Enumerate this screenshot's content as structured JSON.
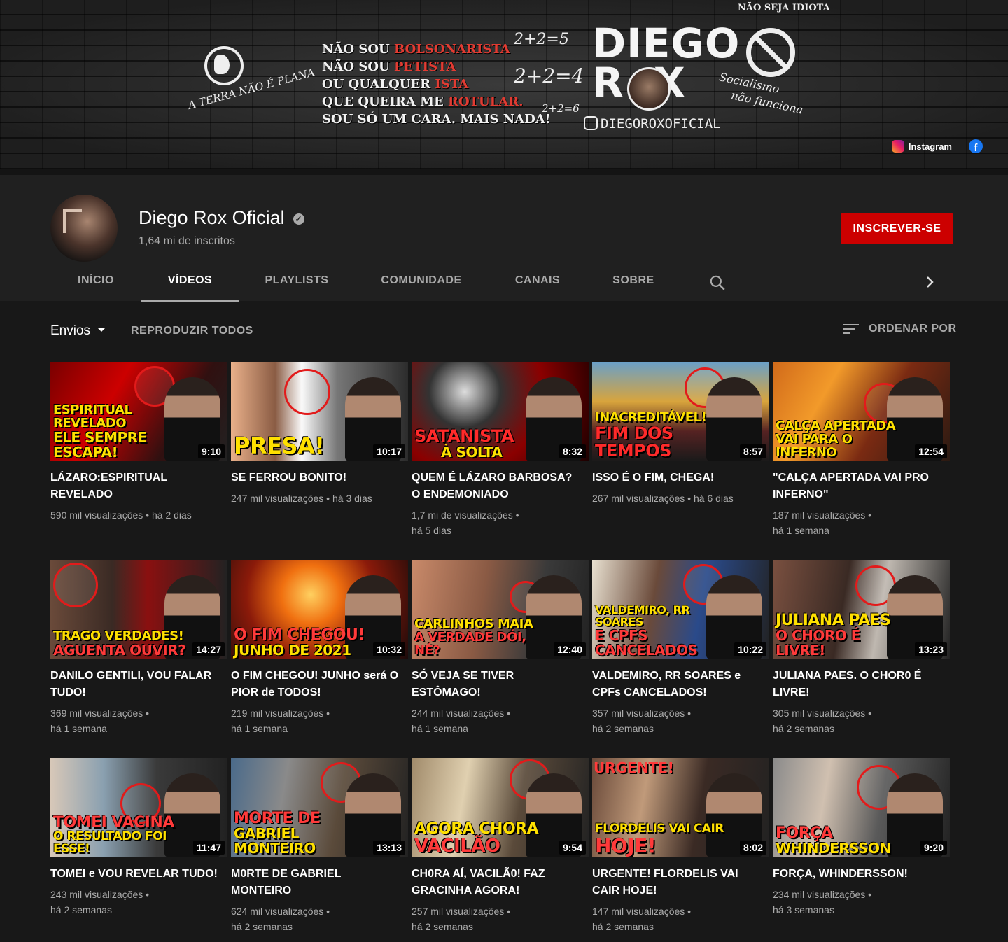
{
  "banner": {
    "flat_earth_text": "A TERRA NÃO É PLANA",
    "manifesto": [
      {
        "pre": "NÃO SOU ",
        "red": "BOLSONARISTA",
        "post": ""
      },
      {
        "pre": "NÃO SOU ",
        "red": "PETISTA",
        "post": ""
      },
      {
        "pre": "OU QUALQUER ",
        "red": "ISTA",
        "post": ""
      },
      {
        "pre": "QUE QUEIRA ME ",
        "red": "ROTULAR.",
        "post": ""
      },
      {
        "pre": "SOU SÓ UM CARA. MAIS NADA!",
        "red": "",
        "post": ""
      }
    ],
    "math": [
      "2+2=5",
      "2+2=4",
      "2+2=6"
    ],
    "logo_line1": "DIEGO",
    "logo_line2": "R  X",
    "handle": "DIEGOROXOFICIAL",
    "nao_seja": "NÃO SEJA IDIOTA",
    "socialismo_1": "Socialismo",
    "socialismo_2": "não funciona",
    "instagram_label": "Instagram",
    "facebook_glyph": "f"
  },
  "channel": {
    "name": "Diego Rox Oficial",
    "verified_glyph": "✓",
    "subscribers": "1,64 mi de inscritos",
    "subscribe_label": "INSCREVER-SE"
  },
  "tabs": [
    {
      "label": "INÍCIO"
    },
    {
      "label": "VÍDEOS"
    },
    {
      "label": "PLAYLISTS"
    },
    {
      "label": "COMUNIDADE"
    },
    {
      "label": "CANAIS"
    },
    {
      "label": "SOBRE"
    }
  ],
  "toolbar": {
    "uploads_label": "Envios",
    "play_all_label": "REPRODUZIR TODOS",
    "sort_label": "ORDENAR POR"
  },
  "videos": [
    {
      "title": "LÁZARO:ESPIRITUAL REVELADO",
      "views": "590 mil visualizações",
      "age": "há 2 dias",
      "duration": "9:10",
      "cap1": "ESPIRITUAL REVELADO",
      "cap2": "ELE SEMPRE ESCAPA!"
    },
    {
      "title": "SE FERROU BONITO!",
      "views": "247 mil visualizações",
      "age": "há 3 dias",
      "duration": "10:17",
      "cap1": "",
      "cap2": "PRESA!"
    },
    {
      "title": "QUEM É LÁZARO BARBOSA? O ENDEMONIADO",
      "views": "1,7 mi de visualizações",
      "age": "há 5 dias",
      "duration": "8:32",
      "cap1": "SATANISTA",
      "cap2": "À SOLTA"
    },
    {
      "title": "ISSO É O FIM, CHEGA!",
      "views": "267 mil visualizações",
      "age": "há 6 dias",
      "duration": "8:57",
      "cap1": "INACREDITÁVEL!",
      "cap2": "FIM DOS TEMPOS"
    },
    {
      "title": "\"CALÇA APERTADA VAI PRO INFERNO\"",
      "views": "187 mil visualizações",
      "age": "há 1 semana",
      "duration": "12:54",
      "cap1": "CALÇA APERTADA",
      "cap2": "VAI PARA O INFERNO"
    },
    {
      "title": "DANILO GENTILI, VOU FALAR TUDO!",
      "views": "369 mil visualizações",
      "age": "há 1 semana",
      "duration": "14:27",
      "cap1": "TRAGO VERDADES!",
      "cap2": "AGUENTA OUVIR?"
    },
    {
      "title": "O FIM CHEGOU! JUNHO será O PIOR de TODOS!",
      "views": "219 mil visualizações",
      "age": "há 1 semana",
      "duration": "10:32",
      "cap1": "O FIM CHEGOU!",
      "cap2": "JUNHO DE 2021"
    },
    {
      "title": "SÓ VEJA SE TIVER ESTÔMAGO!",
      "views": "244 mil visualizações",
      "age": "há 1 semana",
      "duration": "12:40",
      "cap1": "CARLINHOS MAIA",
      "cap2": "A VERDADE DÓI, NÉ?"
    },
    {
      "title": "VALDEMIRO, RR SOARES e CPFs CANCELADOS!",
      "views": "357 mil visualizações",
      "age": "há 2 semanas",
      "duration": "10:22",
      "cap1": "VALDEMIRO, RR SOARES",
      "cap2": "E CPFS CANCELADOS"
    },
    {
      "title": "JULIANA PAES. O CHOR0 É LIVRE!",
      "views": "305 mil visualizações",
      "age": "há 2 semanas",
      "duration": "13:23",
      "cap1": "JULIANA PAES",
      "cap2": "O CHORO É LIVRE!"
    },
    {
      "title": "TOMEI e VOU REVELAR TUDO!",
      "views": "243 mil visualizações",
      "age": "há 2 semanas",
      "duration": "11:47",
      "cap1": "TOMEI VACINA",
      "cap2": "O RESULTADO FOI ESSE!"
    },
    {
      "title": "M0RTE DE GABRIEL MONTEIRO",
      "views": "624 mil visualizações",
      "age": "há 2 semanas",
      "duration": "13:13",
      "cap1": "MORTE DE",
      "cap2": "GABRIEL MONTEIRO"
    },
    {
      "title": "CH0RA AÍ, VACILÃ0! FAZ GRACINHA AGORA!",
      "views": "257 mil visualizações",
      "age": "há 2 semanas",
      "duration": "9:54",
      "cap1": "AGORA CHORA",
      "cap2": "VACILÃO"
    },
    {
      "title": "URGENTE! FLORDELIS VAI CAIR HOJE!",
      "views": "147 mil visualizações",
      "age": "há 2 semanas",
      "duration": "8:02",
      "cap1": "FLORDELIS VAI CAIR",
      "cap2": "HOJE!"
    },
    {
      "title": "FORÇA, WHINDERSSON!",
      "views": "234 mil visualizações",
      "age": "há 3 semanas",
      "duration": "9:20",
      "cap1": "FORÇA",
      "cap2": "WHINDERSSON"
    }
  ]
}
